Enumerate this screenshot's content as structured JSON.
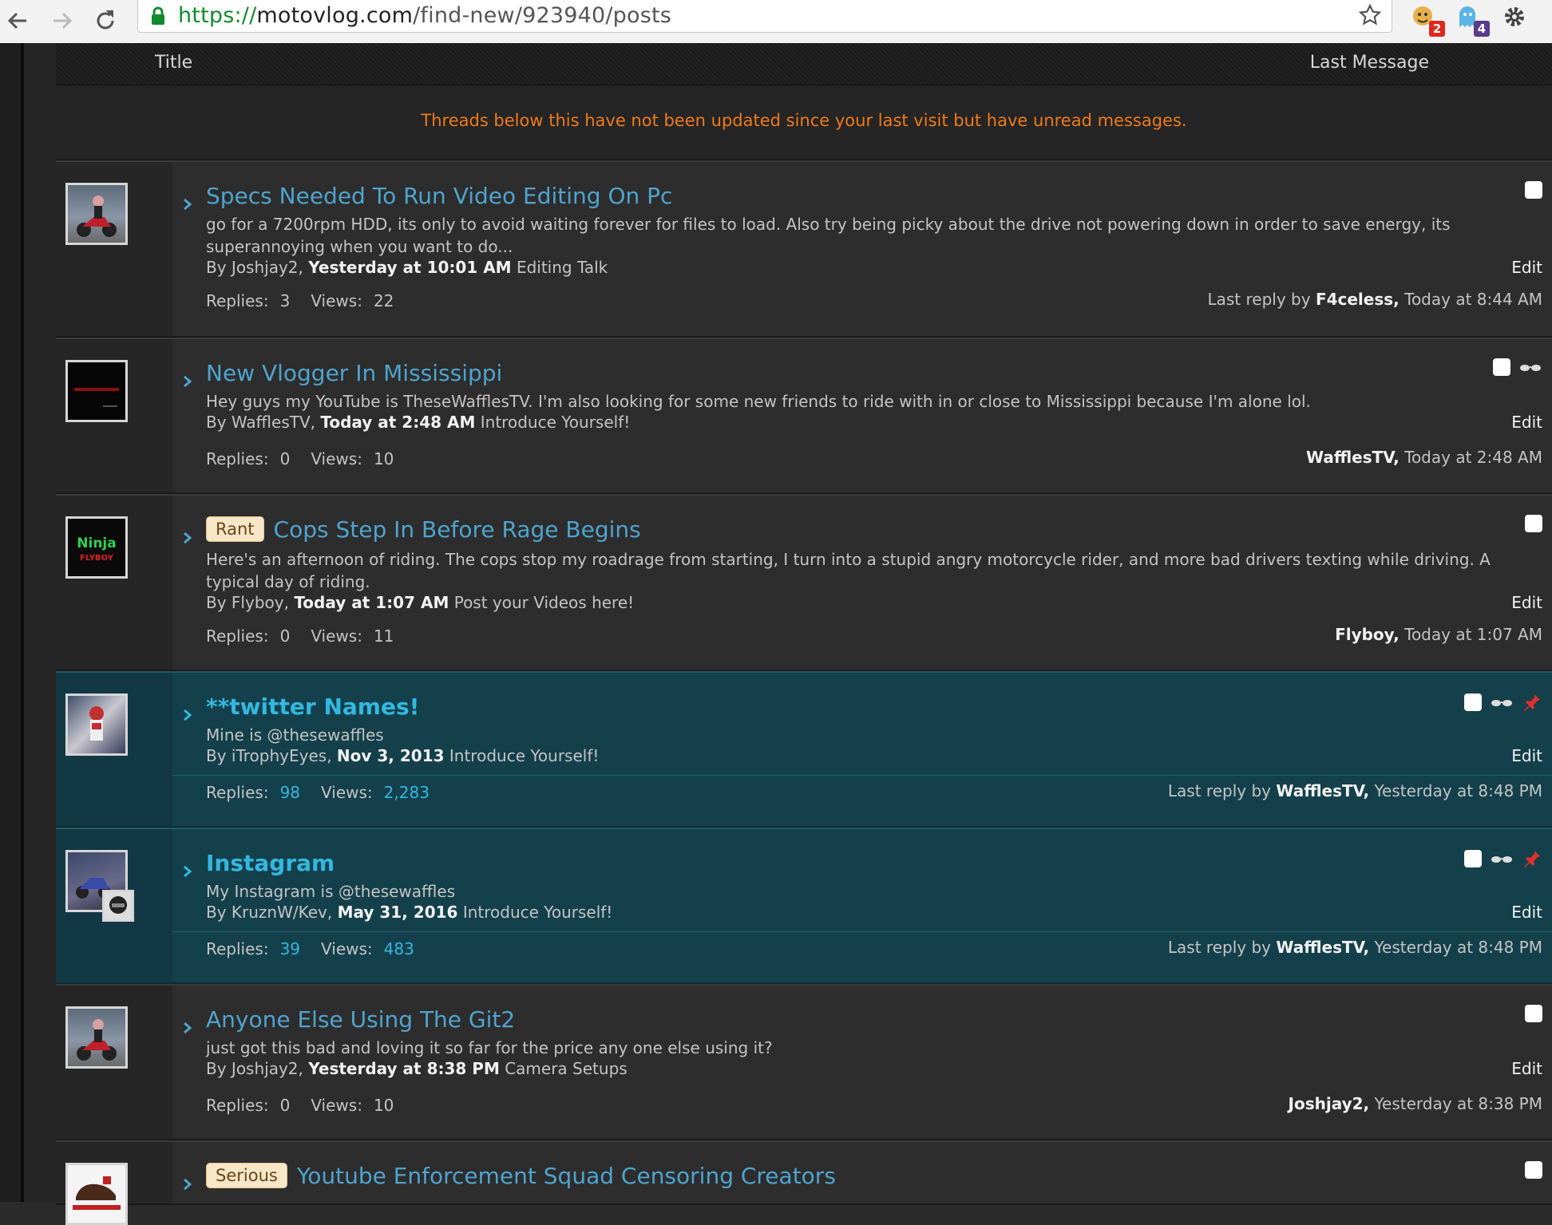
{
  "browser": {
    "url_scheme": "https://",
    "url_host": "motovlog.com",
    "url_path": "/find-new/923940/posts",
    "ext_badge_1": "2",
    "ext_badge_2": "4"
  },
  "header": {
    "title_col": "Title",
    "last_col": "Last Message"
  },
  "notice": "Threads below this have not been updated since your last visit but have unread messages.",
  "labels": {
    "replies": "Replies:",
    "views": "Views:",
    "edit": "Edit",
    "by": "By"
  },
  "threads": [
    {
      "prefix": "",
      "title": "Specs Needed To Run Video Editing On Pc",
      "snippet": "go for a 7200rpm HDD, its only to avoid waiting forever for files to load. Also try being picky about the drive not powering down in order to save energy, its superannoying when you want to do...",
      "author": "Joshjay2",
      "date": "Yesterday at 10:01 AM",
      "forum": "Editing Talk",
      "replies": "3",
      "views": "22",
      "last_prefix": "Last reply by",
      "last_user": "F4celess,",
      "last_time": "Today at 8:44 AM"
    },
    {
      "prefix": "",
      "title": "New Vlogger In Mississippi",
      "snippet": "Hey guys my YouTube is TheseWafflesTV. I'm also looking for some new friends to ride with in or close to Mississippi because I'm alone lol.",
      "author": "WafflesTV",
      "date": "Today at 2:48 AM",
      "forum": "Introduce Yourself!",
      "replies": "0",
      "views": "10",
      "last_prefix": "",
      "last_user": "WafflesTV,",
      "last_time": "Today at 2:48 AM"
    },
    {
      "prefix": "Rant",
      "title": "Cops Step In Before Rage Begins",
      "snippet": "Here's an afternoon of riding. The cops stop my roadrage from starting, I turn into a stupid angry motorcycle rider, and more bad drivers texting while driving. A typical day of riding.",
      "author": "Flyboy",
      "date": "Today at 1:07 AM",
      "forum": "Post your Videos here!",
      "replies": "0",
      "views": "11",
      "last_prefix": "",
      "last_user": "Flyboy,",
      "last_time": "Today at 1:07 AM",
      "avatar_text_1": "Ninja",
      "avatar_text_2": "FLYBOY"
    },
    {
      "prefix": "",
      "title": "**twitter Names!",
      "snippet": "Mine is @thesewaffles",
      "author": "iTrophyEyes",
      "date": "Nov 3, 2013",
      "forum": "Introduce Yourself!",
      "replies": "98",
      "views": "2,283",
      "last_prefix": "Last reply by",
      "last_user": "WafflesTV,",
      "last_time": "Yesterday at 8:48 PM"
    },
    {
      "prefix": "",
      "title": "Instagram",
      "snippet": "My Instagram is @thesewaffles",
      "author": "KruznW/Kev",
      "date": "May 31, 2016",
      "forum": "Introduce Yourself!",
      "replies": "39",
      "views": "483",
      "last_prefix": "Last reply by",
      "last_user": "WafflesTV,",
      "last_time": "Yesterday at 8:48 PM"
    },
    {
      "prefix": "",
      "title": "Anyone Else Using The Git2",
      "snippet": "just got this bad and loving it so far for the price any one else using it?",
      "author": "Joshjay2",
      "date": "Yesterday at 8:38 PM",
      "forum": "Camera Setups",
      "replies": "0",
      "views": "10",
      "last_prefix": "",
      "last_user": "Joshjay2,",
      "last_time": "Yesterday at 8:38 PM"
    },
    {
      "prefix": "Serious",
      "title": "Youtube Enforcement Squad Censoring Creators"
    }
  ],
  "colors": {
    "accent_link": "#4fa4cf",
    "sticky_bg": "#14404c",
    "notice": "#f07a1a"
  }
}
